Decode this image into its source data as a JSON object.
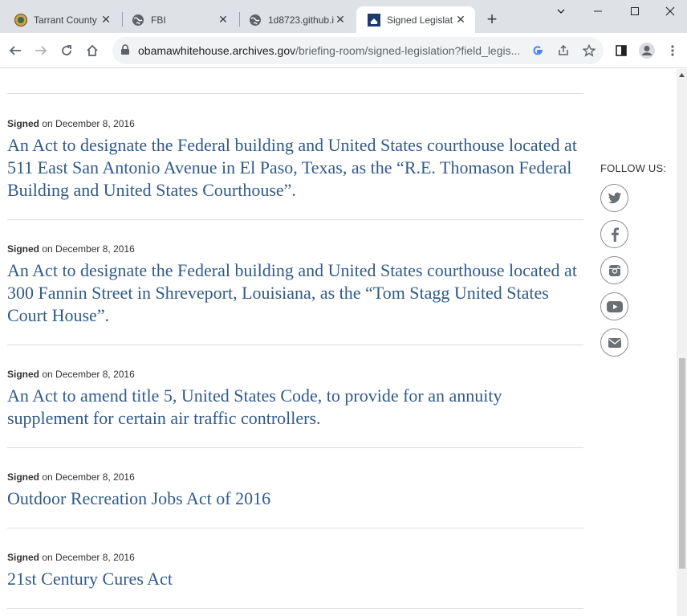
{
  "browser": {
    "tabs": [
      {
        "title": "Tarrant County"
      },
      {
        "title": "FBI"
      },
      {
        "title": "1d8723.github.i"
      },
      {
        "title": "Signed Legislat"
      }
    ],
    "url_host": "obamawhitehouse.archives.gov",
    "url_path": "/briefing-room/signed-legislation?field_legis..."
  },
  "page": {
    "follow_label": "FOLLOW US:",
    "social_icons": [
      "twitter-icon",
      "facebook-icon",
      "instagram-icon",
      "youtube-icon",
      "email-icon"
    ],
    "entries": [
      {
        "status": "Signed",
        "date": "on December 8, 2016",
        "title": "An Act to designate the Federal building and United States courthouse located at 511 East San Antonio Avenue in El Paso, Texas, as the “R.E. Thomason Federal Building and United States Courthouse”."
      },
      {
        "status": "Signed",
        "date": "on December 8, 2016",
        "title": "An Act to designate the Federal building and United States courthouse located at 300 Fannin Street in Shreveport, Louisiana, as the “Tom Stagg United States Court House”."
      },
      {
        "status": "Signed",
        "date": "on December 8, 2016",
        "title": "An Act to amend title 5, United States Code, to provide for an annuity supplement for certain air traffic controllers."
      },
      {
        "status": "Signed",
        "date": "on December 8, 2016",
        "title": "Outdoor Recreation Jobs Act of 2016"
      },
      {
        "status": "Signed",
        "date": "on December 8, 2016",
        "title": "21st Century Cures Act"
      }
    ],
    "colors": {
      "headline": "#305a8a",
      "separator": "#dcdcdc"
    }
  }
}
